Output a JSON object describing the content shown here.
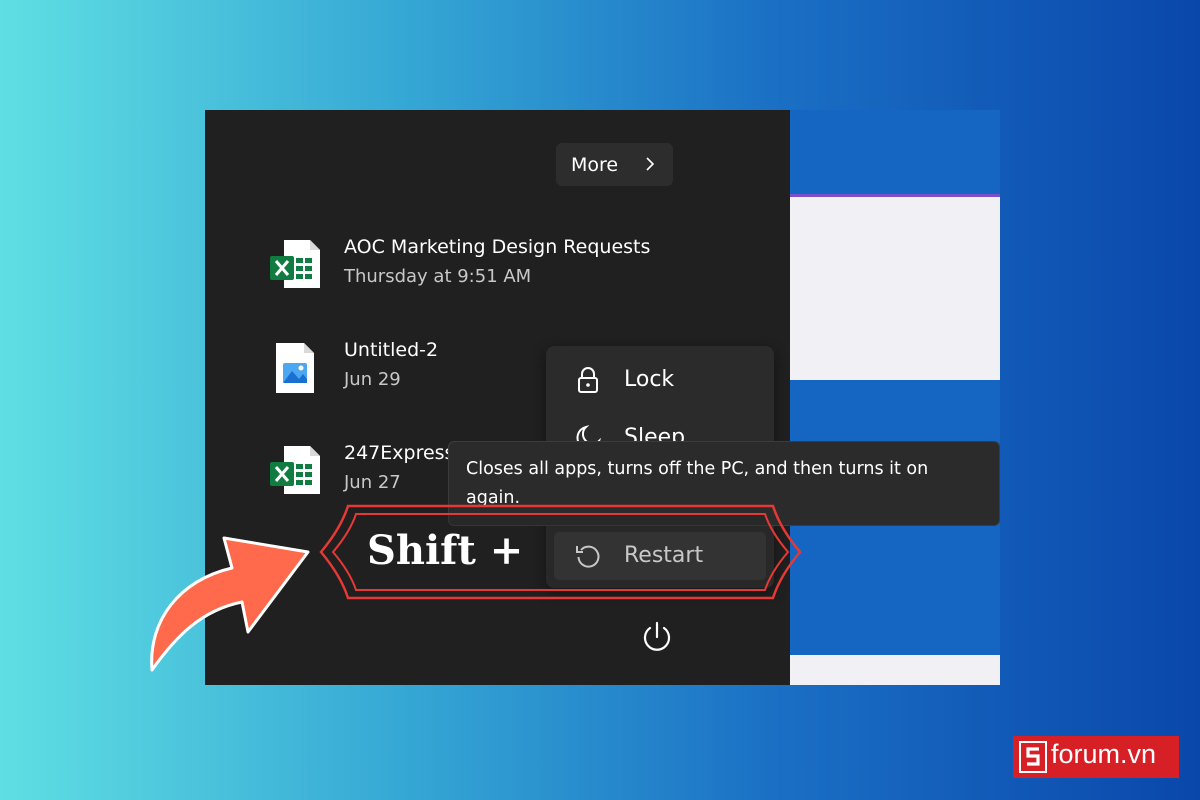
{
  "more_button": {
    "label": "More"
  },
  "recent": [
    {
      "name": "AOC Marketing Design Requests",
      "date": "Thursday at 9:51 AM",
      "icon": "excel-file-icon"
    },
    {
      "name": "Untitled-2",
      "date": "Jun 29",
      "icon": "image-file-icon"
    },
    {
      "name": "247Express",
      "date": "Jun 27",
      "icon": "excel-file-icon"
    }
  ],
  "power_menu": {
    "items": [
      {
        "label": "Lock",
        "icon": "lock-icon"
      },
      {
        "label": "Sleep",
        "icon": "moon-icon"
      },
      {
        "label": "Restart",
        "icon": "restart-icon"
      }
    ]
  },
  "tooltip": {
    "text": "Closes all apps, turns off the PC, and then turns it on again."
  },
  "overlay": {
    "shift_label": "Shift +"
  },
  "brand": {
    "text": "forum.vn",
    "color": "#d71f26"
  },
  "colors": {
    "panel": "#202020",
    "excel_green": "#107c41",
    "accent_red": "#d71f26",
    "arrow": "#ff6a4d"
  }
}
